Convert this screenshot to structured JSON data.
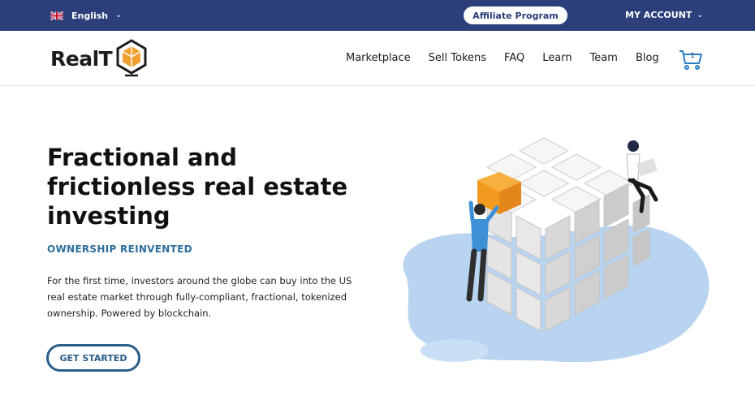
{
  "topbar": {
    "language": "English",
    "affiliate_label": "Affiliate Program",
    "account_label": "MY ACCOUNT"
  },
  "header": {
    "logo_text": "RealT",
    "nav": [
      "Marketplace",
      "Sell Tokens",
      "FAQ",
      "Learn",
      "Team",
      "Blog"
    ],
    "cart_count": "1"
  },
  "hero": {
    "title_lines": [
      "Fractional and",
      "frictionless real estate",
      "investing"
    ],
    "subtitle": "OWNERSHIP REINVENTED",
    "description": "For the first time, investors around the globe can buy into the US real estate market through fully-compliant, fractional, tokenized ownership. Powered by blockchain.",
    "cta_label": "GET STARTED"
  },
  "colors": {
    "topbar_bg": "#2b3f7a",
    "accent_blue": "#2c6e9e",
    "logo_orange": "#f0a030",
    "blob_blue": "#b8d4f0"
  }
}
